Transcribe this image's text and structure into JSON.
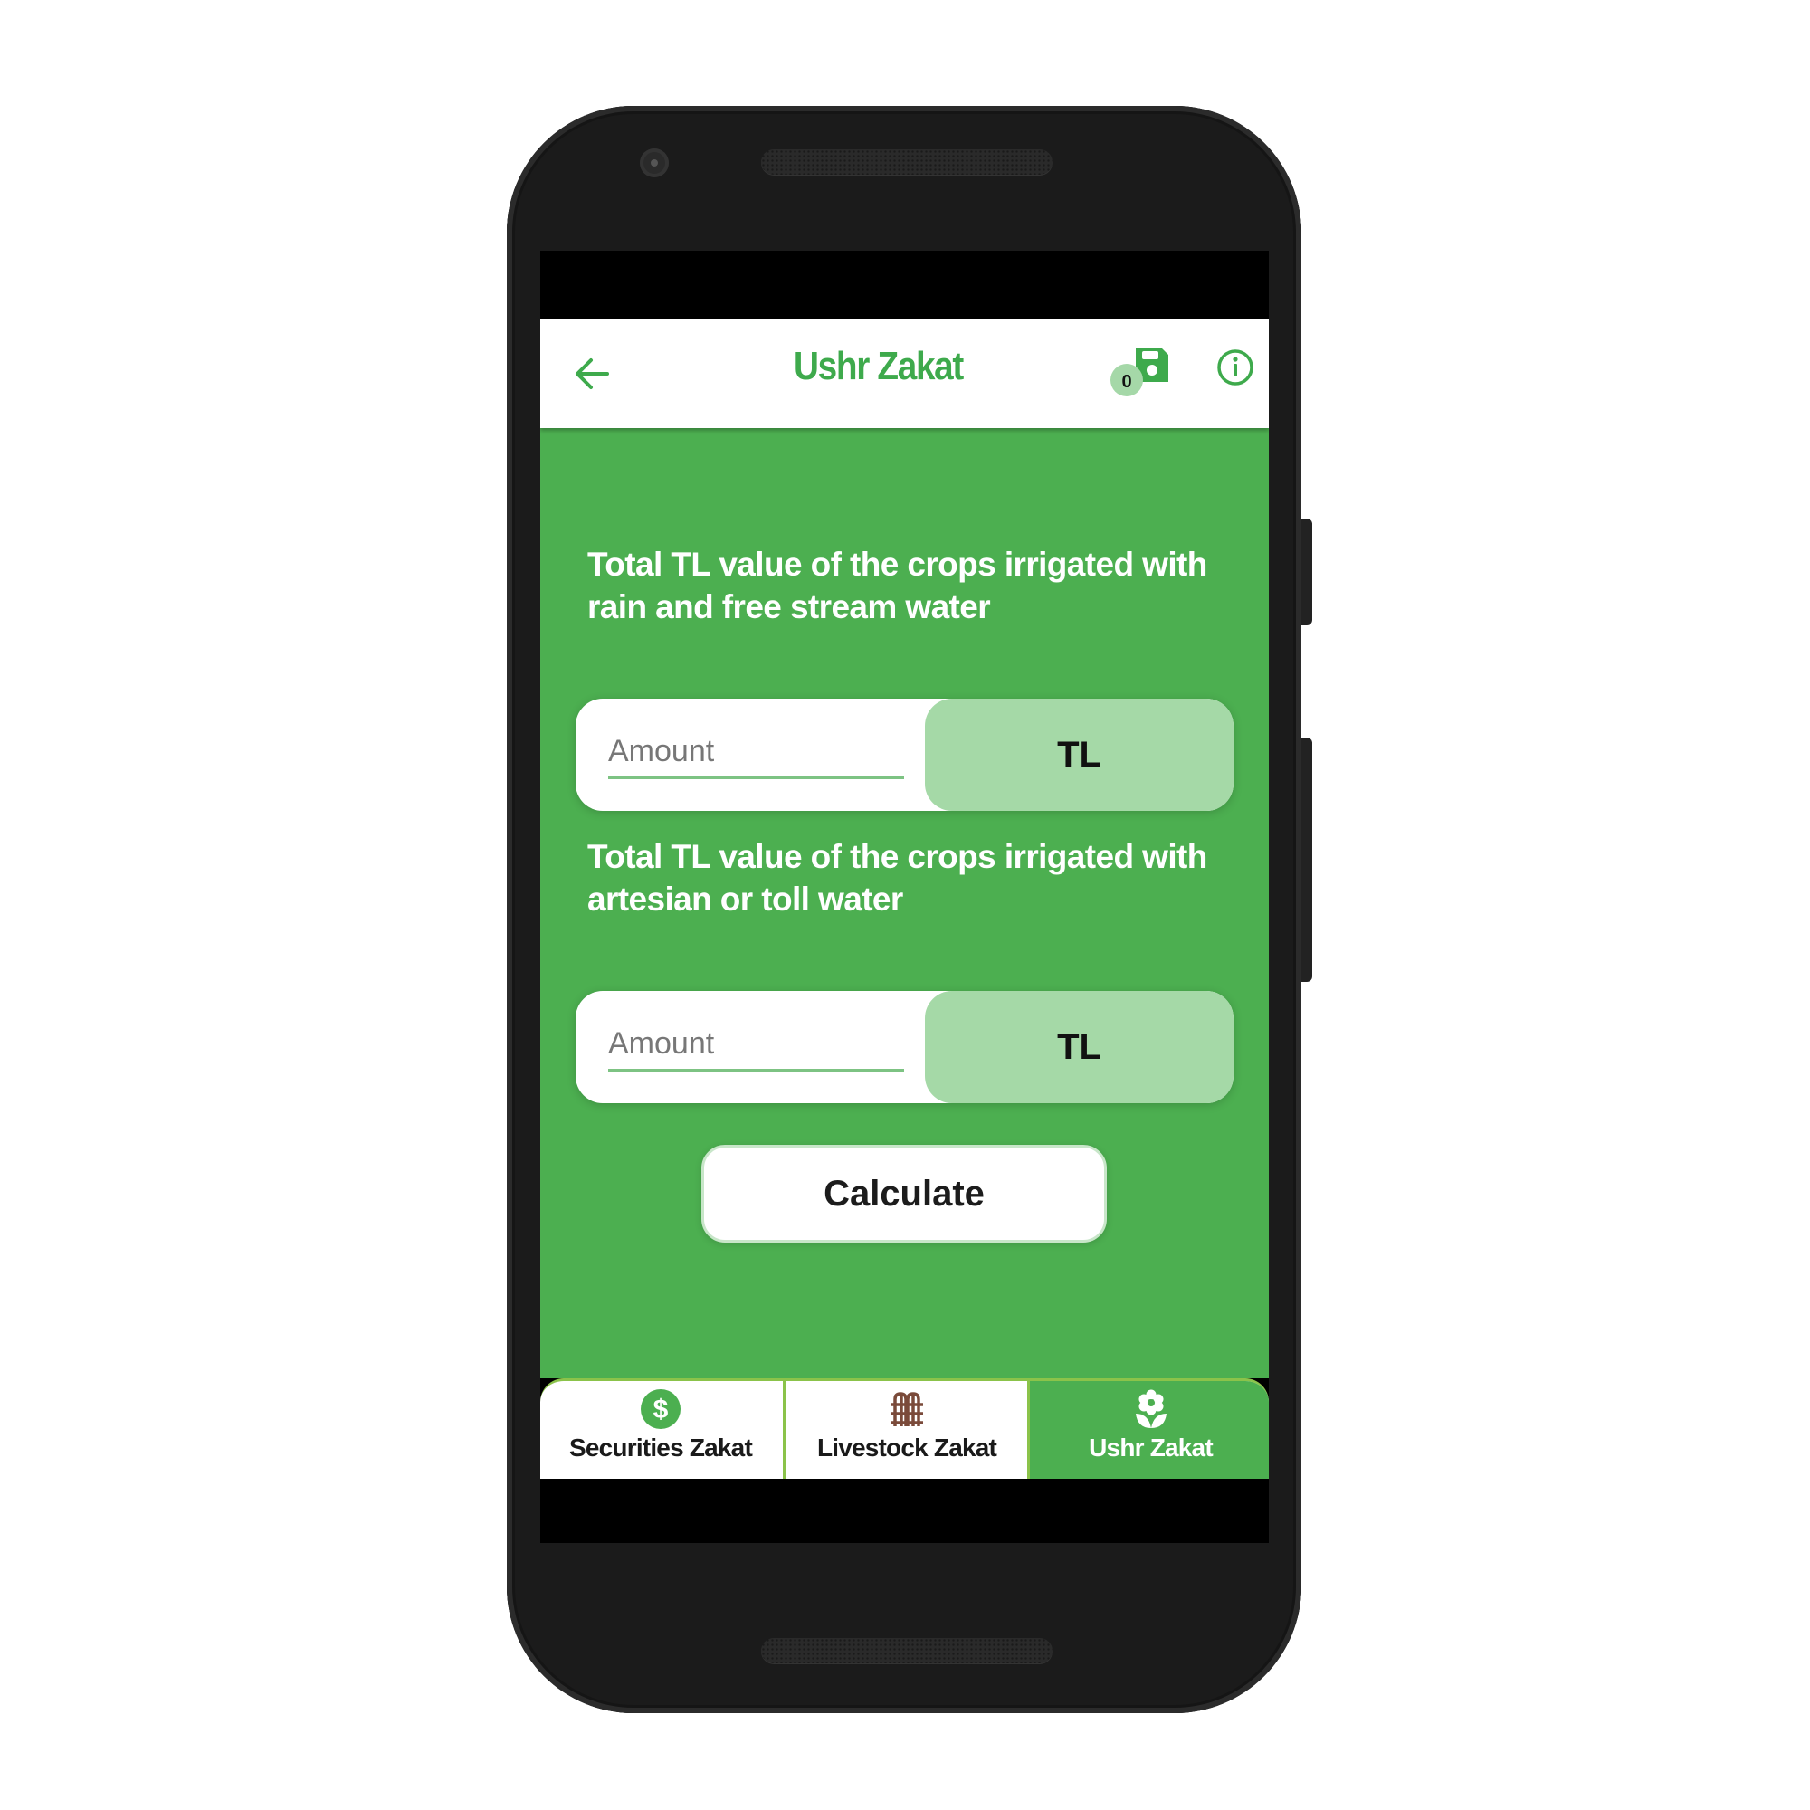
{
  "app": {
    "title": "Ushr Zakat",
    "accent_color": "#4caf50",
    "header_text_color": "#3eaa4c"
  },
  "header": {
    "back_icon": "arrow-left-icon",
    "save_icon": "floppy-disk-icon",
    "saved_count": "0",
    "info_icon": "info-circle-icon"
  },
  "form": {
    "fields": [
      {
        "label": "Total TL value of the crops irrigated with rain and free stream water",
        "placeholder": "Amount",
        "value": "",
        "currency": "TL"
      },
      {
        "label": "Total TL value of the crops irrigated with artesian or toll water",
        "placeholder": "Amount",
        "value": "",
        "currency": "TL"
      }
    ],
    "calculate_label": "Calculate"
  },
  "bottom_nav": {
    "active_index": 2,
    "tabs": [
      {
        "label": "Securities Zakat",
        "icon": "dollar-circle-icon",
        "icon_color": "#4caf50"
      },
      {
        "label": "Livestock Zakat",
        "icon": "fence-icon",
        "icon_color": "#7a4a3a"
      },
      {
        "label": "Ushr Zakat",
        "icon": "flower-plant-icon",
        "icon_color": "#ffffff"
      }
    ]
  }
}
